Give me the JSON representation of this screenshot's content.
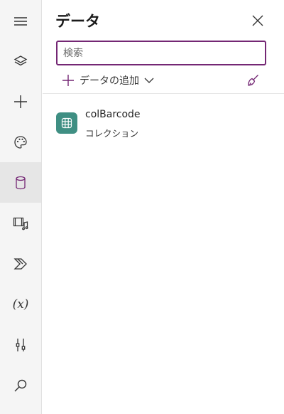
{
  "rail": {
    "items": [
      {
        "name": "menu-icon"
      },
      {
        "name": "layers-icon"
      },
      {
        "name": "plus-icon"
      },
      {
        "name": "palette-icon"
      },
      {
        "name": "database-icon",
        "active": true
      },
      {
        "name": "media-icon"
      },
      {
        "name": "power-automate-icon"
      },
      {
        "name": "variables-icon",
        "label": "(x)"
      },
      {
        "name": "tools-icon"
      },
      {
        "name": "search-icon"
      }
    ]
  },
  "panel": {
    "title": "データ",
    "search": {
      "placeholder": "検索",
      "value": ""
    },
    "add_data_label": "データの追加",
    "items": [
      {
        "name": "colBarcode",
        "type": "コレクション",
        "icon": "table-icon"
      }
    ]
  },
  "colors": {
    "accent": "#742774",
    "item_icon_bg": "#3f8f83",
    "rail_bg": "#f5f5f5",
    "rail_active_bg": "#e6e6e6"
  }
}
